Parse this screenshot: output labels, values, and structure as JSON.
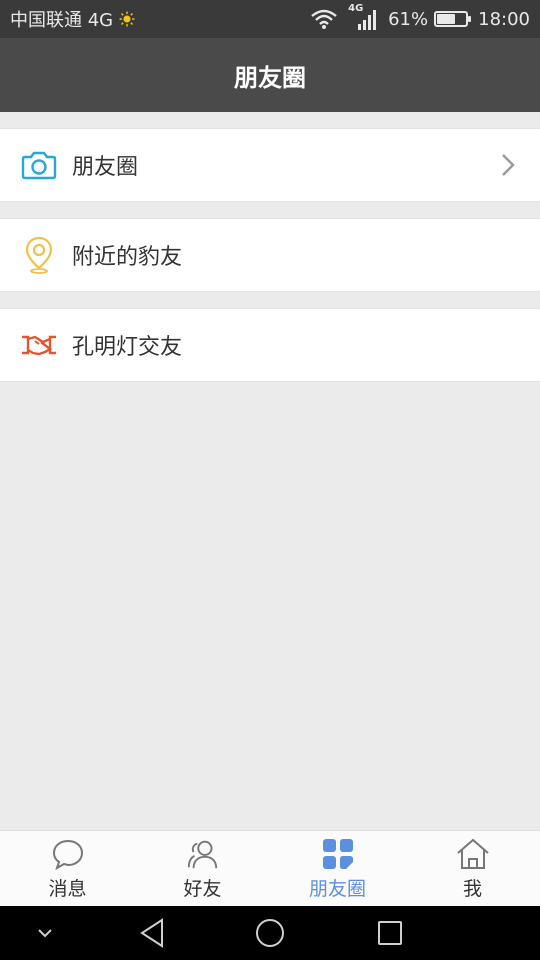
{
  "status_bar": {
    "carrier": "中国联通 4G",
    "signal_tag": "4G",
    "battery": "61%",
    "battery_level": 0.61,
    "time": "18:00"
  },
  "header": {
    "title": "朋友圈"
  },
  "list": [
    {
      "label": "朋友圈",
      "icon": "camera-icon",
      "color": "#29a6d8",
      "has_chevron": true
    },
    {
      "label": "附近的豹友",
      "icon": "location-pin-icon",
      "color": "#f0c24a",
      "has_chevron": false
    },
    {
      "label": "孔明灯交友",
      "icon": "handshake-icon",
      "color": "#e2572f",
      "has_chevron": false
    }
  ],
  "bottom_nav": [
    {
      "label": "消息",
      "icon": "chat-bubble-icon",
      "active": false
    },
    {
      "label": "好友",
      "icon": "friends-icon",
      "active": false
    },
    {
      "label": "朋友圈",
      "icon": "moments-grid-icon",
      "active": true
    },
    {
      "label": "我",
      "icon": "home-icon",
      "active": false
    }
  ],
  "colors": {
    "status_bar_bg": "#3a3a3a",
    "title_bar_bg": "#4a4a4a",
    "page_bg": "#ebebeb",
    "active_tab": "#5b8fe0"
  },
  "system_nav": {
    "buttons": [
      "collapse-icon",
      "back-icon",
      "home-circle-icon",
      "recents-icon"
    ]
  }
}
